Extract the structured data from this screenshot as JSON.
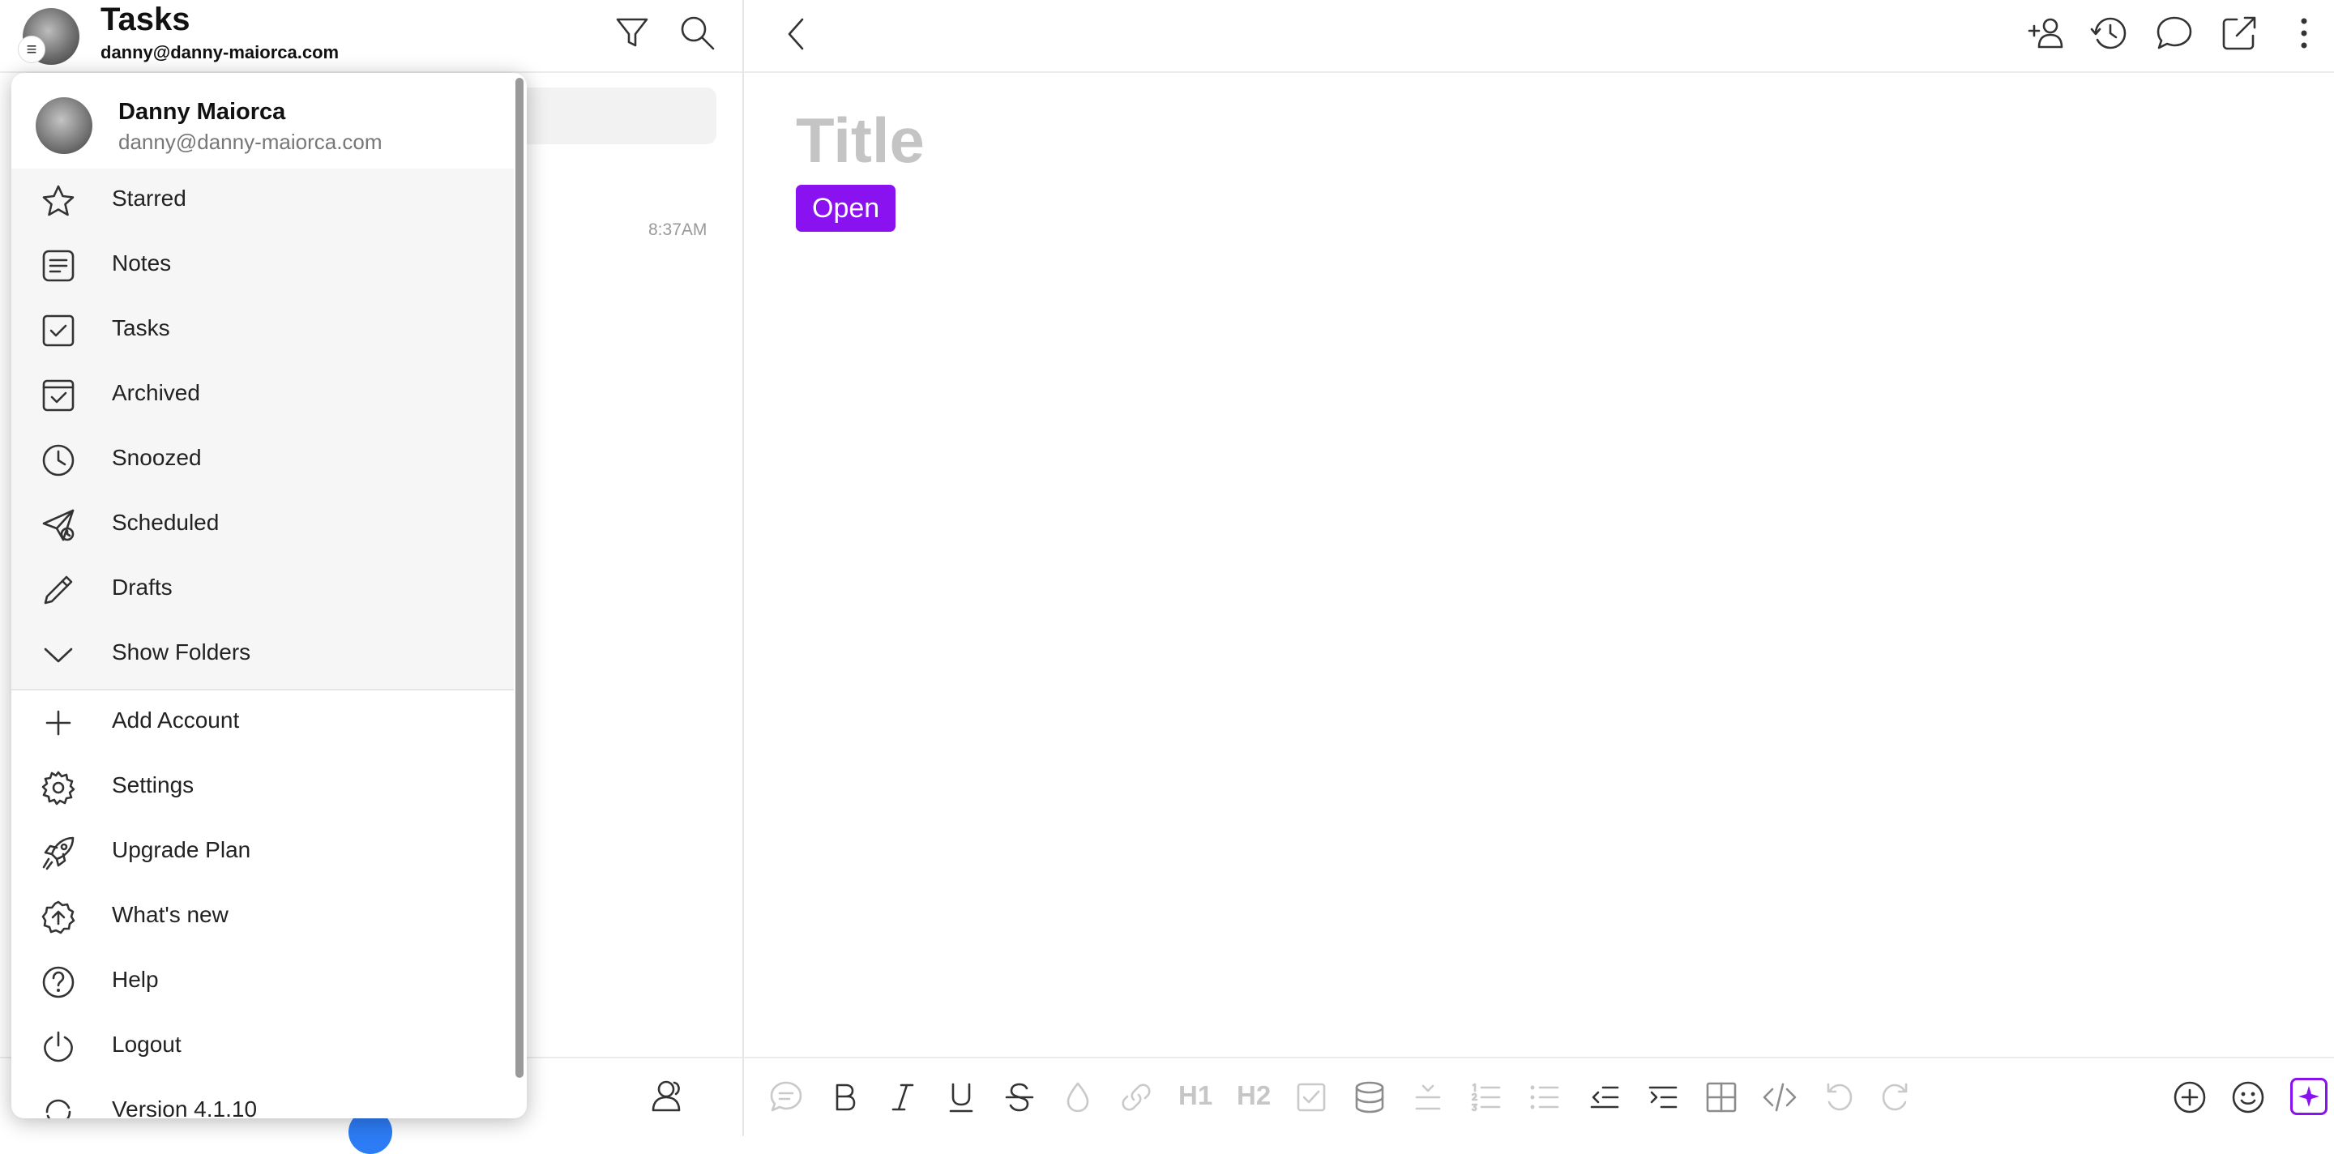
{
  "header": {
    "title": "Tasks",
    "email": "danny@danny-maiorca.com"
  },
  "list": {
    "time": "8:37AM"
  },
  "drawer": {
    "profile": {
      "name": "Danny Maiorca",
      "email": "danny@danny-maiorca.com"
    },
    "nav_items": [
      {
        "label": "Starred",
        "icon": "star-icon"
      },
      {
        "label": "Notes",
        "icon": "notes-icon"
      },
      {
        "label": "Tasks",
        "icon": "task-check-icon"
      },
      {
        "label": "Archived",
        "icon": "archive-icon"
      },
      {
        "label": "Snoozed",
        "icon": "clock-icon"
      },
      {
        "label": "Scheduled",
        "icon": "send-clock-icon"
      },
      {
        "label": "Drafts",
        "icon": "pencil-icon"
      },
      {
        "label": "Show Folders",
        "icon": "chevron-down-icon"
      }
    ],
    "account_items": [
      {
        "label": "Add Account",
        "icon": "plus-icon"
      },
      {
        "label": "Settings",
        "icon": "gear-icon"
      },
      {
        "label": "Upgrade Plan",
        "icon": "rocket-icon"
      },
      {
        "label": "What's new",
        "icon": "whats-new-icon"
      },
      {
        "label": "Help",
        "icon": "help-icon"
      },
      {
        "label": "Logout",
        "icon": "power-icon"
      },
      {
        "label": "Version 4.1.10",
        "icon": "refresh-icon"
      }
    ]
  },
  "editor": {
    "title_placeholder": "Title",
    "status_badge": "Open",
    "toolbar_text": {
      "h1": "H1",
      "h2": "H2"
    }
  },
  "colors": {
    "accent": "#8a12f0",
    "badge_blue": "#2d7cf6"
  }
}
